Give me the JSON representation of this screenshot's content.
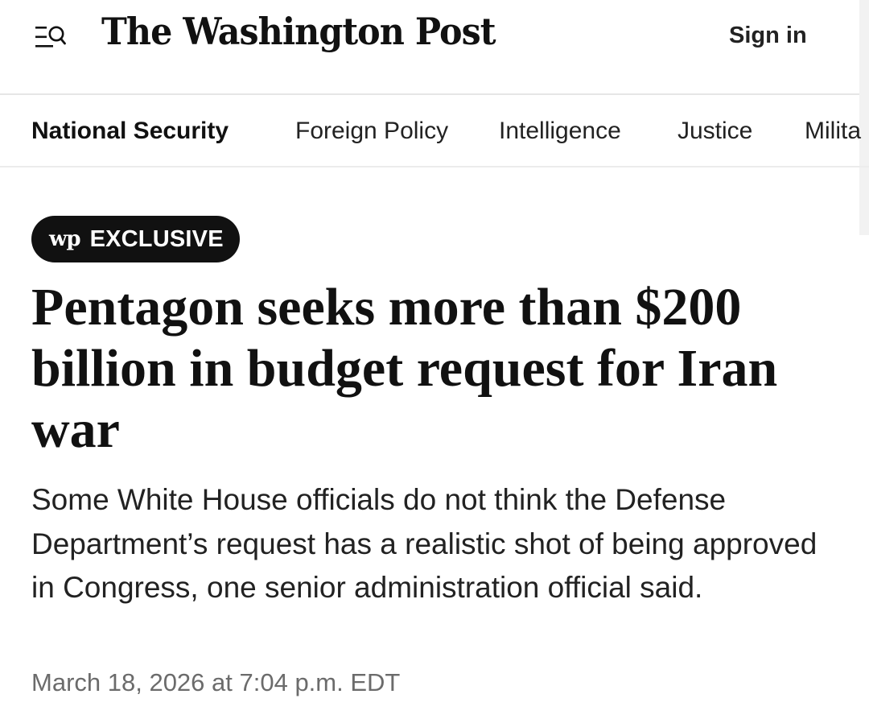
{
  "header": {
    "menu_icon": "menu-search-icon",
    "masthead": "The Washington Post",
    "sign_in_label": "Sign in"
  },
  "section_nav": {
    "items": [
      {
        "label": "National Security",
        "active": true
      },
      {
        "label": "Foreign Policy",
        "active": false
      },
      {
        "label": "Intelligence",
        "active": false
      },
      {
        "label": "Justice",
        "active": false
      },
      {
        "label": "Milita",
        "active": false
      }
    ]
  },
  "article": {
    "badge_logo": "wp",
    "badge_label": "EXCLUSIVE",
    "headline": "Pentagon seeks more than $200 billion in budget request for Iran war",
    "dek": "Some White House officials do not think the Defense Department’s request has a realistic shot of being approved in Congress, one senior administration official said.",
    "dateline": "March 18, 2026 at 7:04 p.m. EDT"
  },
  "colors": {
    "text": "#111111",
    "muted": "#6b6b6b",
    "badge_bg": "#111111",
    "divider": "#e6e6e6"
  }
}
